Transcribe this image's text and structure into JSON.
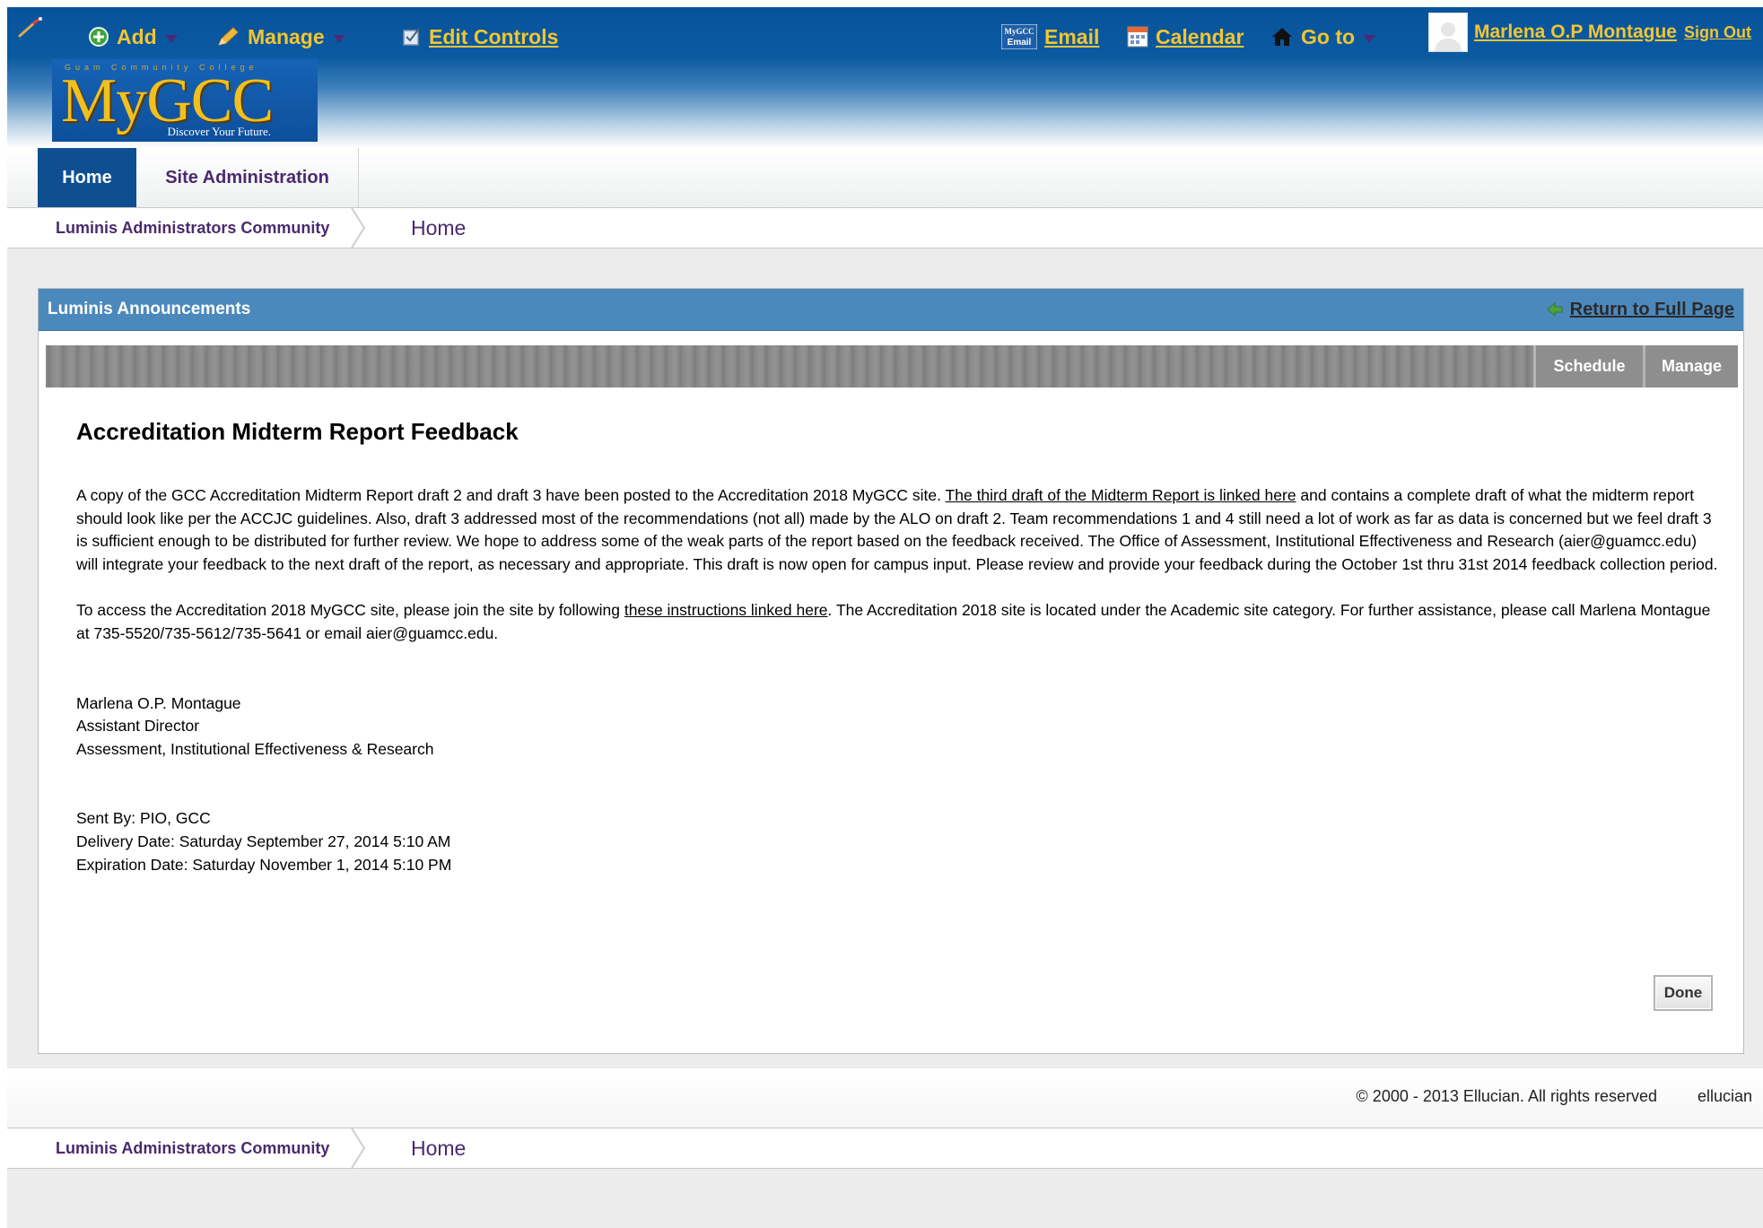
{
  "topnav": {
    "add_label": "Add",
    "manage_label": "Manage",
    "edit_controls_label": "Edit Controls",
    "email_icon_text": "MyGCC Email",
    "email_label": "Email",
    "calendar_label": "Calendar",
    "goto_label": "Go to",
    "user_name": "Marlena O.P Montague",
    "sign_out_label": "Sign Out"
  },
  "logo": {
    "college": "Guam Community College",
    "brand": "MyGCC",
    "tagline": "Discover Your Future."
  },
  "tabs": [
    {
      "label": "Home",
      "active": true
    },
    {
      "label": "Site Administration",
      "active": false
    }
  ],
  "breadcrumb": {
    "community": "Luminis Administrators Community",
    "current": "Home"
  },
  "portlet": {
    "title": "Luminis Announcements",
    "return_label": "Return to Full Page",
    "toolbar": {
      "schedule_label": "Schedule",
      "manage_label": "Manage"
    }
  },
  "announcement": {
    "title": "Accreditation Midterm Report Feedback",
    "p1_before": "A copy of the GCC Accreditation Midterm Report draft 2 and draft 3 have been posted to the Accreditation 2018 MyGCC site.  ",
    "p1_link": "The third draft of the Midterm Report is linked here",
    "p1_after": " and contains a complete draft of what the midterm report should look like per the ACCJC guidelines.  Also, draft 3 addressed most of the recommendations (not all) made by the ALO on draft 2. Team recommendations 1 and 4 still need a lot of work as far as data is concerned but we feel draft 3 is sufficient enough to be distributed for further review.  We hope to address some of the weak parts of the report based on the feedback received.  The Office of Assessment, Institutional Effectiveness and Research (aier@guamcc.edu) will integrate your feedback to the next draft of the report, as necessary and appropriate. This draft is now open for campus input.  Please review and provide your feedback during the October 1st thru 31st 2014 feedback collection period.",
    "p2_before": "To access the Accreditation 2018 MyGCC site, please join the site by following ",
    "p2_link": "these instructions linked here",
    "p2_after": ". The Accreditation 2018 site is located under the Academic site category. For further assistance, please call Marlena Montague at 735-5520/735-5612/735-5641 or email aier@guamcc.edu.",
    "sig_name": "Marlena O.P. Montague",
    "sig_title": "Assistant Director",
    "sig_dept": "Assessment, Institutional Effectiveness & Research",
    "sent_by": "Sent By: PIO, GCC",
    "delivery_date": "Delivery Date: Saturday September 27, 2014 5:10 AM",
    "expiration_date": "Expiration Date: Saturday November 1, 2014 5:10 PM",
    "done_label": "Done"
  },
  "footer": {
    "copyright": "© 2000 - 2013 Ellucian. All rights reserved",
    "brand": "ellucian"
  },
  "colors": {
    "header_blue": "#08539a",
    "nav_gold": "#f2c532",
    "active_tab": "#0e4f92",
    "portlet_header": "#4b89bd",
    "purple_text": "#4a2a6e"
  }
}
